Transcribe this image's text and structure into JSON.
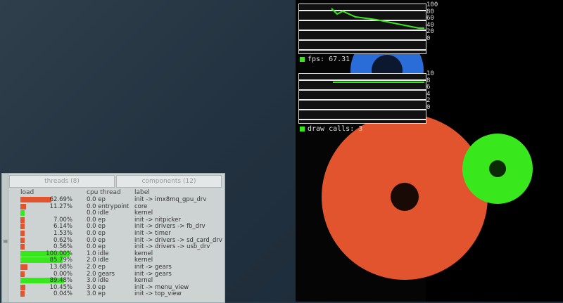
{
  "colors": {
    "green": "#39e81c",
    "red": "#e2542e",
    "blue": "#2a6dd8"
  },
  "fps_graph": {
    "axis": [
      "100",
      "80",
      "60",
      "40",
      "20",
      "0"
    ],
    "caption": "fps: 67.31",
    "icon": "green-square"
  },
  "draw_graph": {
    "axis": [
      "10",
      "8",
      "6",
      "4",
      "2",
      "0"
    ],
    "caption": "draw calls: 3",
    "icon": "green-square"
  },
  "window": {
    "tabs": [
      "threads (8)",
      "components (12)"
    ],
    "headers": {
      "load": "load",
      "cpu": "cpu thread",
      "label": "label"
    },
    "handle_icon": "grip-handle-icon",
    "rows": [
      {
        "load": "62.69%",
        "cpu": "0.0 ep",
        "label": "init -> imx8mq_gpu_drv",
        "bar": "red",
        "fill": 0.63
      },
      {
        "load": "11.27%",
        "cpu": "0.0 entrypoint",
        "label": "core",
        "bar": "red",
        "fill": 0.11
      },
      {
        "load": "",
        "cpu": "0.0 idle",
        "label": "kernel",
        "bar": "green",
        "fill": 0.06
      },
      {
        "load": "7.00%",
        "cpu": "0.0 ep",
        "label": "init -> nitpicker",
        "bar": "red",
        "fill": 0.07
      },
      {
        "load": "6.14%",
        "cpu": "0.0 ep",
        "label": "init -> drivers -> fb_drv",
        "bar": "red",
        "fill": 0.06
      },
      {
        "load": "1.53%",
        "cpu": "0.0 ep",
        "label": "init -> timer",
        "bar": "red",
        "fill": 0.02
      },
      {
        "load": "0.62%",
        "cpu": "0.0 ep",
        "label": "init -> drivers -> sd_card_drv",
        "bar": "red",
        "fill": 0.01
      },
      {
        "load": "0.56%",
        "cpu": "0.0 ep",
        "label": "init -> drivers -> usb_drv",
        "bar": "red",
        "fill": 0.01
      },
      {
        "load": "100.00%",
        "cpu": "1.0 idle",
        "label": "kernel",
        "bar": "green",
        "fill": 1.0
      },
      {
        "load": "85.79%",
        "cpu": "2.0 idle",
        "label": "kernel",
        "bar": "green",
        "fill": 0.86
      },
      {
        "load": "13.68%",
        "cpu": "2.0 ep",
        "label": "init -> gears",
        "bar": "red",
        "fill": 0.14
      },
      {
        "load": "0.00%",
        "cpu": "2.0 gears",
        "label": "init -> gears",
        "bar": "red",
        "fill": 0.0
      },
      {
        "load": "89.48%",
        "cpu": "3.0 idle",
        "label": "kernel",
        "bar": "green",
        "fill": 0.89
      },
      {
        "load": "10.45%",
        "cpu": "3.0 ep",
        "label": "init -> menu_view",
        "bar": "red",
        "fill": 0.1
      },
      {
        "load": "0.04%",
        "cpu": "3.0 ep",
        "label": "init -> top_view",
        "bar": "red",
        "fill": 0.0
      }
    ]
  }
}
